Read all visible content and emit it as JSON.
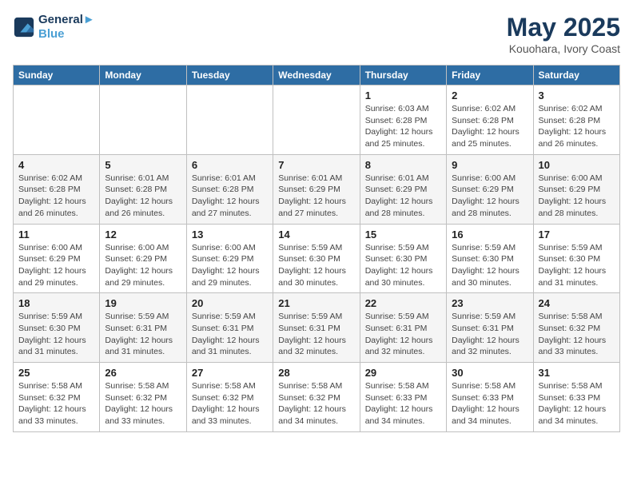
{
  "logo": {
    "line1": "General",
    "line2": "Blue"
  },
  "title": "May 2025",
  "subtitle": "Kouohara, Ivory Coast",
  "days_of_week": [
    "Sunday",
    "Monday",
    "Tuesday",
    "Wednesday",
    "Thursday",
    "Friday",
    "Saturday"
  ],
  "weeks": [
    [
      {
        "day": "",
        "detail": ""
      },
      {
        "day": "",
        "detail": ""
      },
      {
        "day": "",
        "detail": ""
      },
      {
        "day": "",
        "detail": ""
      },
      {
        "day": "1",
        "detail": "Sunrise: 6:03 AM\nSunset: 6:28 PM\nDaylight: 12 hours and 25 minutes."
      },
      {
        "day": "2",
        "detail": "Sunrise: 6:02 AM\nSunset: 6:28 PM\nDaylight: 12 hours and 25 minutes."
      },
      {
        "day": "3",
        "detail": "Sunrise: 6:02 AM\nSunset: 6:28 PM\nDaylight: 12 hours and 26 minutes."
      }
    ],
    [
      {
        "day": "4",
        "detail": "Sunrise: 6:02 AM\nSunset: 6:28 PM\nDaylight: 12 hours and 26 minutes."
      },
      {
        "day": "5",
        "detail": "Sunrise: 6:01 AM\nSunset: 6:28 PM\nDaylight: 12 hours and 26 minutes."
      },
      {
        "day": "6",
        "detail": "Sunrise: 6:01 AM\nSunset: 6:28 PM\nDaylight: 12 hours and 27 minutes."
      },
      {
        "day": "7",
        "detail": "Sunrise: 6:01 AM\nSunset: 6:29 PM\nDaylight: 12 hours and 27 minutes."
      },
      {
        "day": "8",
        "detail": "Sunrise: 6:01 AM\nSunset: 6:29 PM\nDaylight: 12 hours and 28 minutes."
      },
      {
        "day": "9",
        "detail": "Sunrise: 6:00 AM\nSunset: 6:29 PM\nDaylight: 12 hours and 28 minutes."
      },
      {
        "day": "10",
        "detail": "Sunrise: 6:00 AM\nSunset: 6:29 PM\nDaylight: 12 hours and 28 minutes."
      }
    ],
    [
      {
        "day": "11",
        "detail": "Sunrise: 6:00 AM\nSunset: 6:29 PM\nDaylight: 12 hours and 29 minutes."
      },
      {
        "day": "12",
        "detail": "Sunrise: 6:00 AM\nSunset: 6:29 PM\nDaylight: 12 hours and 29 minutes."
      },
      {
        "day": "13",
        "detail": "Sunrise: 6:00 AM\nSunset: 6:29 PM\nDaylight: 12 hours and 29 minutes."
      },
      {
        "day": "14",
        "detail": "Sunrise: 5:59 AM\nSunset: 6:30 PM\nDaylight: 12 hours and 30 minutes."
      },
      {
        "day": "15",
        "detail": "Sunrise: 5:59 AM\nSunset: 6:30 PM\nDaylight: 12 hours and 30 minutes."
      },
      {
        "day": "16",
        "detail": "Sunrise: 5:59 AM\nSunset: 6:30 PM\nDaylight: 12 hours and 30 minutes."
      },
      {
        "day": "17",
        "detail": "Sunrise: 5:59 AM\nSunset: 6:30 PM\nDaylight: 12 hours and 31 minutes."
      }
    ],
    [
      {
        "day": "18",
        "detail": "Sunrise: 5:59 AM\nSunset: 6:30 PM\nDaylight: 12 hours and 31 minutes."
      },
      {
        "day": "19",
        "detail": "Sunrise: 5:59 AM\nSunset: 6:31 PM\nDaylight: 12 hours and 31 minutes."
      },
      {
        "day": "20",
        "detail": "Sunrise: 5:59 AM\nSunset: 6:31 PM\nDaylight: 12 hours and 31 minutes."
      },
      {
        "day": "21",
        "detail": "Sunrise: 5:59 AM\nSunset: 6:31 PM\nDaylight: 12 hours and 32 minutes."
      },
      {
        "day": "22",
        "detail": "Sunrise: 5:59 AM\nSunset: 6:31 PM\nDaylight: 12 hours and 32 minutes."
      },
      {
        "day": "23",
        "detail": "Sunrise: 5:59 AM\nSunset: 6:31 PM\nDaylight: 12 hours and 32 minutes."
      },
      {
        "day": "24",
        "detail": "Sunrise: 5:58 AM\nSunset: 6:32 PM\nDaylight: 12 hours and 33 minutes."
      }
    ],
    [
      {
        "day": "25",
        "detail": "Sunrise: 5:58 AM\nSunset: 6:32 PM\nDaylight: 12 hours and 33 minutes."
      },
      {
        "day": "26",
        "detail": "Sunrise: 5:58 AM\nSunset: 6:32 PM\nDaylight: 12 hours and 33 minutes."
      },
      {
        "day": "27",
        "detail": "Sunrise: 5:58 AM\nSunset: 6:32 PM\nDaylight: 12 hours and 33 minutes."
      },
      {
        "day": "28",
        "detail": "Sunrise: 5:58 AM\nSunset: 6:32 PM\nDaylight: 12 hours and 34 minutes."
      },
      {
        "day": "29",
        "detail": "Sunrise: 5:58 AM\nSunset: 6:33 PM\nDaylight: 12 hours and 34 minutes."
      },
      {
        "day": "30",
        "detail": "Sunrise: 5:58 AM\nSunset: 6:33 PM\nDaylight: 12 hours and 34 minutes."
      },
      {
        "day": "31",
        "detail": "Sunrise: 5:58 AM\nSunset: 6:33 PM\nDaylight: 12 hours and 34 minutes."
      }
    ]
  ]
}
